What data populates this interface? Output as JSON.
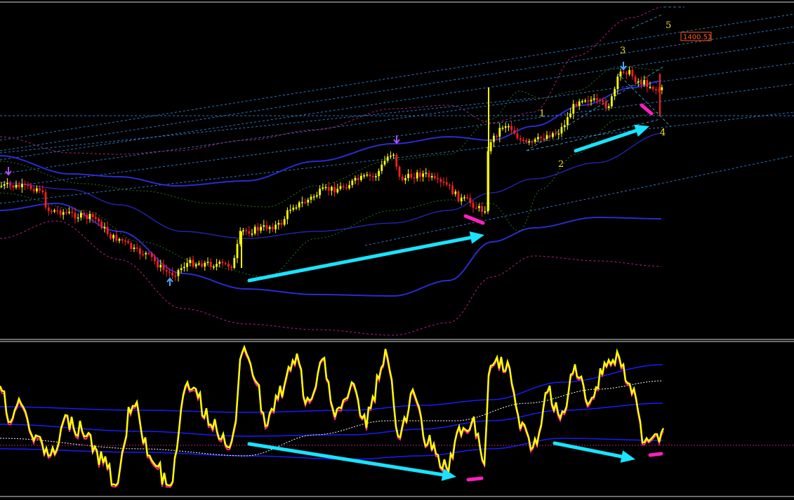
{
  "chart_data": [
    {
      "type": "candlestick",
      "panel": "price",
      "price_label": "1400.51",
      "wave_labels": [
        "1",
        "2",
        "3",
        "4",
        "5"
      ],
      "colors": {
        "background": "#000000",
        "candle_up": "#ffff00",
        "candle_down": "#ff2020",
        "bands_inner": "#2b2bd0",
        "bands_outer": "#b0207a",
        "bands_mid": "#1f7a1f",
        "trend_lines": "#3aa0ff",
        "arrows": "#19e3ff",
        "markers": "#ff1fbf",
        "price_tag": "#ff5a1e"
      }
    },
    {
      "type": "line",
      "panel": "oscillator",
      "colors": {
        "main_line": "#ffff00",
        "signal_line": "#ff2a8a",
        "bands": "#1a1aff",
        "mid_line": "#ffffff"
      }
    }
  ]
}
